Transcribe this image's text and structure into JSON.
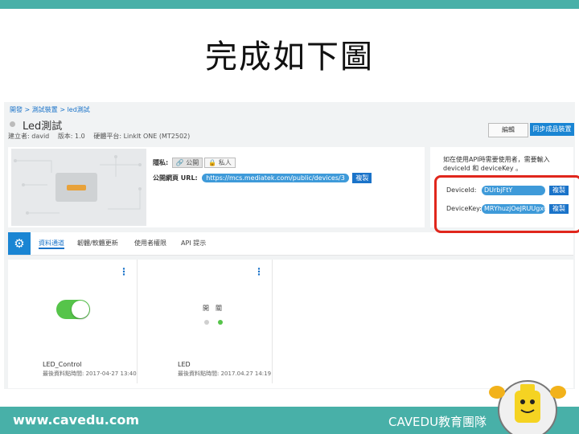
{
  "slide": {
    "title": "完成如下圖"
  },
  "breadcrumb": "開發 > 測試裝置 > led測試",
  "device": {
    "title": "Led測試",
    "creator": "建立者: david",
    "version": "版本: 1.0",
    "platform": "硬體平台: LinkIt ONE (MT2502)"
  },
  "actions": {
    "edit": "編輯",
    "product": "同步成品裝置"
  },
  "permission": {
    "label": "隱私:",
    "public": "公開",
    "private": "私人"
  },
  "url": {
    "label": "公開網頁 URL:",
    "value": "https://mcs.mediatek.com/public/devices/3",
    "copy": "複製"
  },
  "api": {
    "note": "如在使用API時需要使用者，需要輸入 deviceId 和 deviceKey 。",
    "device_id_label": "DeviceId:",
    "device_id_value": "DUrbjFtY",
    "device_key_label": "DeviceKey:",
    "device_key_value": "MRYhuzjOeJRUUgxC",
    "copy": "複製"
  },
  "tabs": [
    "資料通道",
    "韌體/軟體更新",
    "使用者權限",
    "API 提示"
  ],
  "cards": [
    {
      "name": "LED_Control",
      "time": "最後資料點時間: 2017-04-27 13:40",
      "state": "on"
    },
    {
      "name": "LED",
      "time": "最後資料點時間: 2017.04.27 14:19",
      "labels": "開　關"
    }
  ],
  "footer": {
    "url": "www.cavedu.com",
    "brand": "CAVEDU教育團隊"
  },
  "colors": {
    "teal": "#48b0a8",
    "blue": "#1a85d3",
    "highlight": "#e0261c",
    "toggle_on": "#56c44a"
  }
}
